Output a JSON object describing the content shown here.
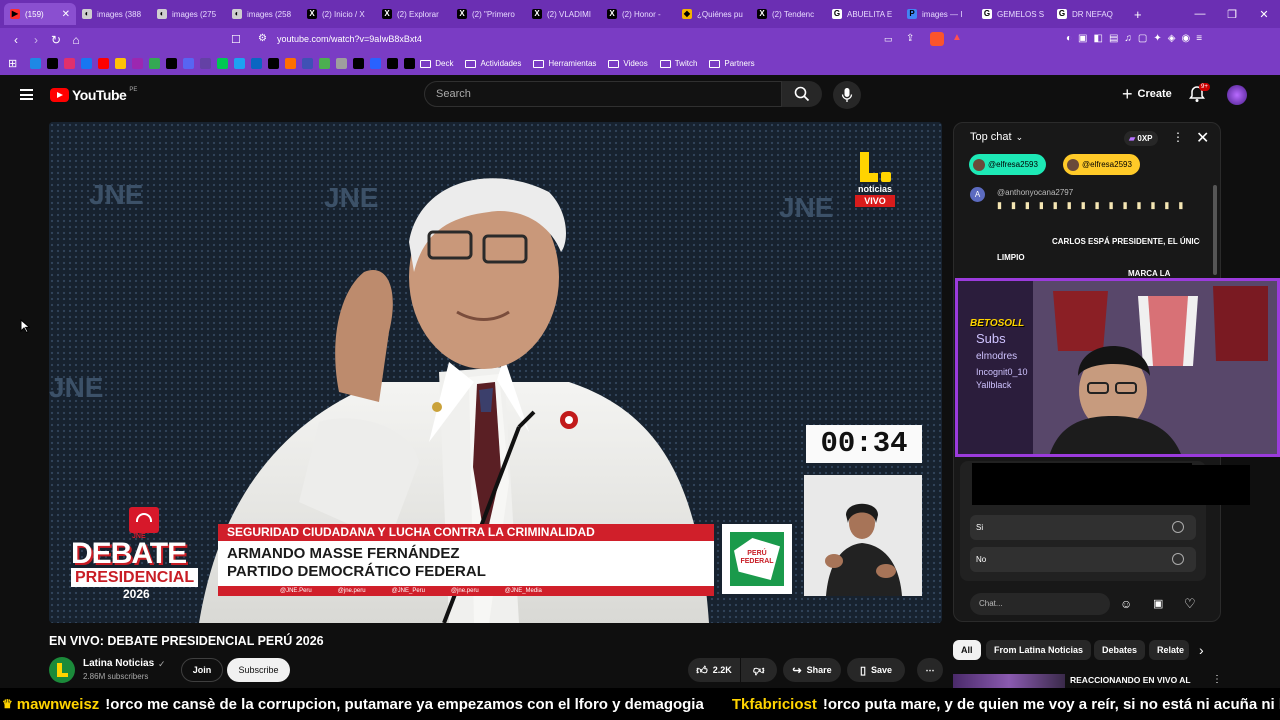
{
  "browser": {
    "tabs": [
      {
        "title": "(159)",
        "color": "#ff2d2d",
        "glyph": "▶"
      },
      {
        "title": "images (388",
        "color": "#cfcfcf",
        "glyph": "◐"
      },
      {
        "title": "images (275",
        "color": "#cfcfcf",
        "glyph": "◐"
      },
      {
        "title": "images (258",
        "color": "#cfcfcf",
        "glyph": "◐"
      },
      {
        "title": "(2) Inicio / X",
        "color": "#000000",
        "glyph": "X"
      },
      {
        "title": "(2) Explorar",
        "color": "#000000",
        "glyph": "X"
      },
      {
        "title": "(2) \"Primero",
        "color": "#000000",
        "glyph": "X"
      },
      {
        "title": "(2) VLADIMI",
        "color": "#000000",
        "glyph": "X"
      },
      {
        "title": "(2) Honor -",
        "color": "#000000",
        "glyph": "X"
      },
      {
        "title": "¿Quiénes pu",
        "color": "#f4b400",
        "glyph": "◆"
      },
      {
        "title": "(2) Tendenc",
        "color": "#000000",
        "glyph": "X"
      },
      {
        "title": "ABUELITA E",
        "color": "#ffffff",
        "glyph": "G"
      },
      {
        "title": "images — I",
        "color": "#4285f4",
        "glyph": "P"
      },
      {
        "title": "GEMELOS S",
        "color": "#ffffff",
        "glyph": "G"
      },
      {
        "title": "DR NEFAQ",
        "color": "#ffffff",
        "glyph": "G"
      }
    ],
    "url": "youtube.com/watch?v=9aIwB8xBxt4",
    "bookmarks": [
      {
        "label": "Deck"
      },
      {
        "label": "Actividades"
      },
      {
        "label": "Herramientas"
      },
      {
        "label": "Videos"
      },
      {
        "label": "Twitch"
      },
      {
        "label": "Partners"
      }
    ],
    "bookmark_icon_colors": [
      "#1e88e5",
      "#000000",
      "#e1306c",
      "#1877f2",
      "#ff0000",
      "#ffc107",
      "#9c27b0",
      "#34a853",
      "#000000",
      "#5865f2",
      "#6441a5",
      "#00c853",
      "#1da1f2",
      "#0a66c2",
      "#000000",
      "#ff6f00",
      "#3f51b5",
      "#4caf50",
      "#9e9e9e",
      "#000000",
      "#2962ff",
      "#000000",
      "#000000"
    ]
  },
  "youtube": {
    "logo_text": "YouTube",
    "region": "PE",
    "search_placeholder": "Search",
    "create_label": "Create",
    "notif_badge": "9+"
  },
  "video": {
    "bg_text": "JNE",
    "channel_bug_line1": "noticias",
    "channel_bug_line2": "VIVO",
    "timer": "00:34",
    "debate_line1": "DEBATE",
    "debate_line2": "PRESIDENCIAL",
    "debate_year": "2026",
    "topic": "SEGURIDAD CIUDADANA Y LUCHA CONTRA LA CRIMINALIDAD",
    "candidate_name": "ARMANDO MASSE FERNÁNDEZ",
    "candidate_party": "PARTIDO DEMOCRÁTICO FEDERAL",
    "socials": [
      "@JNE.Peru",
      "@jne.peru",
      "@JNE_Peru",
      "@jne.peru",
      "@JNE_Media"
    ],
    "party_logo_text": "PERÚ FEDERAL",
    "jne_label": "JNE"
  },
  "chat": {
    "header": "Top chat",
    "xp": "0XP",
    "donors": [
      "@elfresa2593",
      "@elfresa2593"
    ],
    "message_author": "@anthonyocana2797",
    "message_lines": [
      "CARLOS ESPÁ PRESIDENTE, EL ÚNICO",
      "LIMPIO",
      "MARCA LA"
    ],
    "poll_options": [
      "Si",
      "No"
    ],
    "input_placeholder": "Chat...",
    "overlay_texts": [
      "BETOSOLL",
      "Subs",
      "elmodres",
      "Incognit0_10",
      "Yallblack"
    ]
  },
  "below": {
    "title": "EN VIVO: DEBATE PRESIDENCIAL PERÚ 2026",
    "channel": "Latina Noticias",
    "subscribers": "2.86M subscribers",
    "join": "Join",
    "subscribe": "Subscribe",
    "likes": "2.2K",
    "share": "Share",
    "save": "Save",
    "chips": [
      "All",
      "From Latina Noticias",
      "Debates",
      "Relate"
    ],
    "related_title": "REACCIONANDO EN VIVO AL"
  },
  "ticker": [
    {
      "user": "mawnweisz",
      "text": "!orco me cansè de la corrupcion, putamare ya empezamos con el lforo y demagogia"
    },
    {
      "user": "Tkfabriciost",
      "text": "!orco puta mare, y de quien me voy a reír, si no está ni acuña ni keiko"
    }
  ]
}
